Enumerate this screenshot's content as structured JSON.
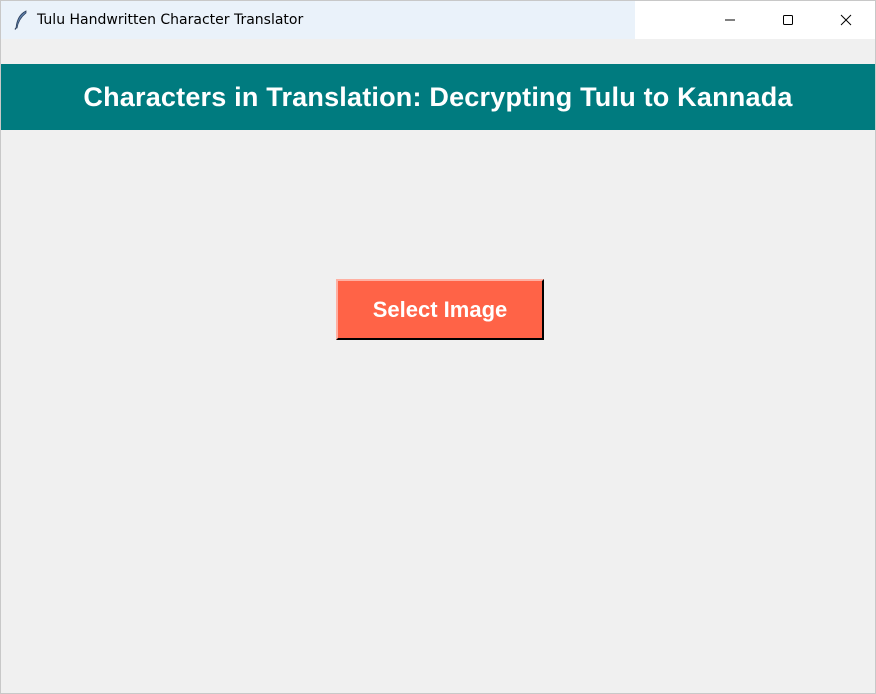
{
  "window": {
    "title": "Tulu Handwritten Character Translator",
    "icon": "feather-icon",
    "controls": [
      "minimize-icon",
      "maximize-icon",
      "close-icon"
    ]
  },
  "header": {
    "title": "Characters in Translation: Decrypting Tulu to Kannada",
    "background_color": "#007b7f",
    "text_color": "#ffffff"
  },
  "main": {
    "select_button_label": "Select Image",
    "select_button_color": "#ff6347"
  }
}
